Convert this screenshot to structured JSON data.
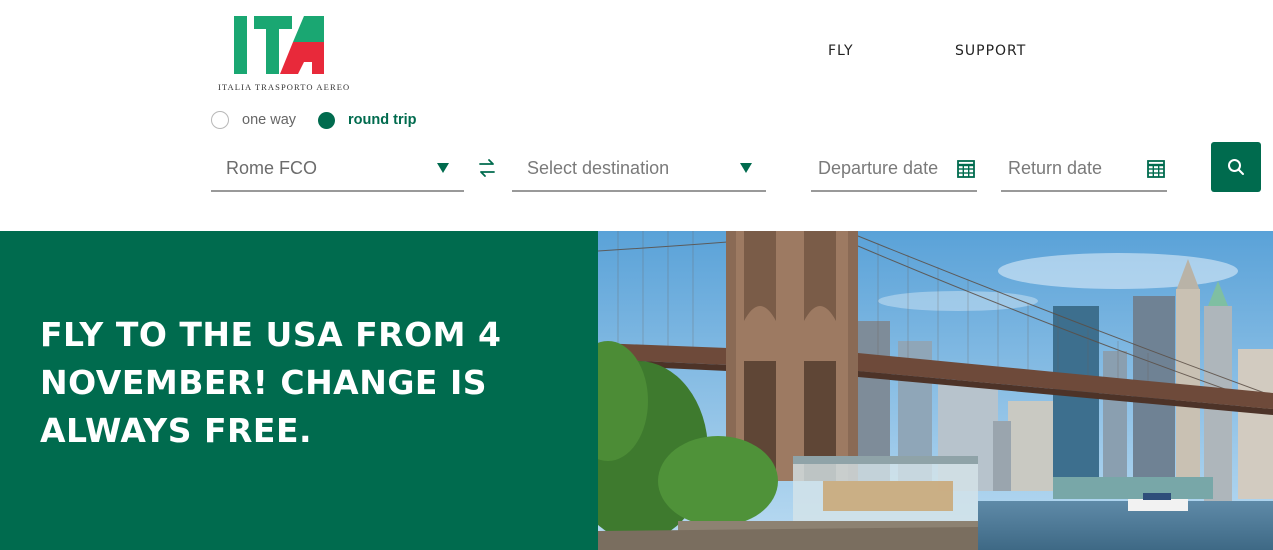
{
  "brand": {
    "logo_text": "ITA",
    "tagline": "ITALIA TRASPORTO AEREO",
    "green": "#1aa772",
    "red": "#e8293a",
    "primary": "#006b4e"
  },
  "nav": {
    "fly": "FLY",
    "support": "SUPPORT"
  },
  "trip_type": {
    "one_way": "one way",
    "round_trip": "round trip",
    "selected": "round trip"
  },
  "search": {
    "origin": "Rome FCO",
    "destination_placeholder": "Select destination",
    "departure_placeholder": "Departure date",
    "return_placeholder": "Return date",
    "swap_icon": "swap-arrows-icon",
    "search_icon": "search-icon"
  },
  "hero": {
    "title": "FLY TO THE USA FROM 4 NOVEMBER! CHANGE IS ALWAYS FREE.",
    "image": "brooklyn-bridge-manhattan-skyline"
  }
}
